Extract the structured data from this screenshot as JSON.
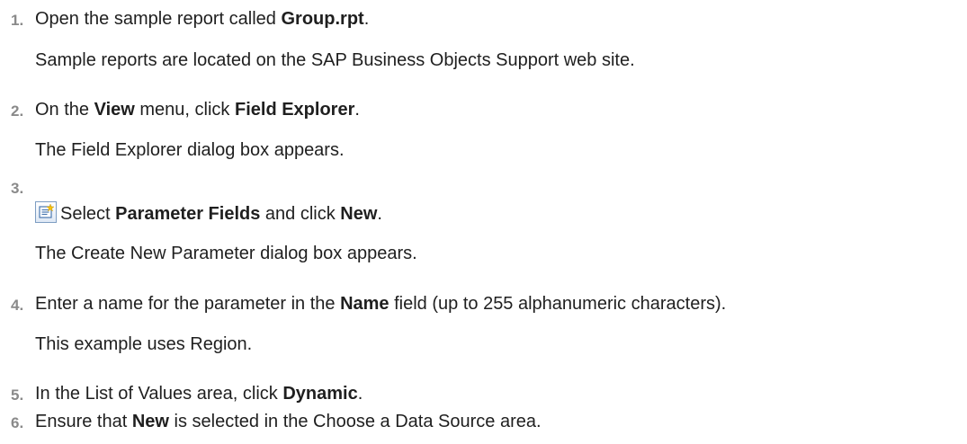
{
  "steps": [
    {
      "number": "1.",
      "parts": [
        "Open the sample report called ",
        "Group.rpt",
        "."
      ],
      "note": "Sample reports are located on the SAP Business Objects Support web site."
    },
    {
      "number": "2.",
      "parts": [
        "On the ",
        "View",
        " menu, click ",
        "Field Explorer",
        "."
      ],
      "note": "The Field Explorer dialog box appears."
    },
    {
      "number": "3.",
      "icon": "new-parameter-icon",
      "parts": [
        "Select ",
        "Parameter Fields",
        " and click ",
        "New",
        "."
      ],
      "note": "The Create New Parameter dialog box appears."
    },
    {
      "number": "4.",
      "parts": [
        "Enter a name for the parameter in the ",
        "Name",
        " field (up to 255 alphanumeric characters)."
      ],
      "note": "This example uses Region."
    },
    {
      "number": "5.",
      "parts": [
        "In the List of Values area, click ",
        "Dynamic",
        "."
      ]
    },
    {
      "number": "6.",
      "parts": [
        "Ensure that ",
        "New",
        " is selected in the Choose a Data Source area."
      ]
    }
  ]
}
